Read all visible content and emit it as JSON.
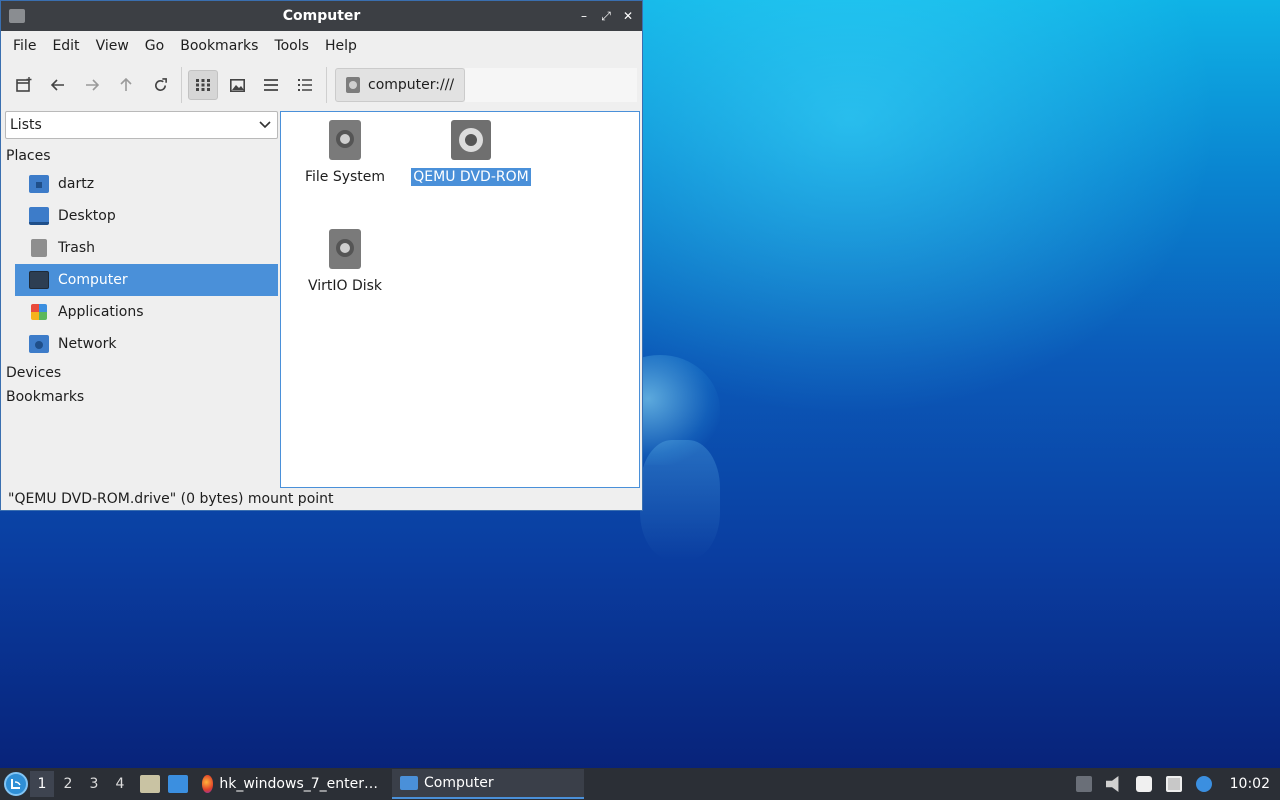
{
  "window": {
    "title": "Computer",
    "controls": {
      "minimize": "–",
      "maximize": "⤢",
      "close": "✕"
    }
  },
  "menubar": {
    "items": [
      "File",
      "Edit",
      "View",
      "Go",
      "Bookmarks",
      "Tools",
      "Help"
    ]
  },
  "toolbar": {
    "icons": [
      "new-tab-icon",
      "back-icon",
      "forward-icon",
      "up-icon",
      "reload-icon",
      "icon-view-icon",
      "thumbnail-view-icon",
      "compact-view-icon",
      "detail-view-icon"
    ],
    "path": "computer:///"
  },
  "sidebar": {
    "selector": "Lists",
    "places_header": "Places",
    "places": [
      {
        "label": "dartz",
        "icon": "home-folder-icon"
      },
      {
        "label": "Desktop",
        "icon": "desktop-icon"
      },
      {
        "label": "Trash",
        "icon": "trash-icon"
      },
      {
        "label": "Computer",
        "icon": "computer-icon",
        "selected": true
      },
      {
        "label": "Applications",
        "icon": "applications-icon"
      },
      {
        "label": "Network",
        "icon": "network-icon"
      }
    ],
    "devices_header": "Devices",
    "bookmarks_header": "Bookmarks"
  },
  "files": [
    {
      "label": "File System",
      "icon": "drive-icon"
    },
    {
      "label": "QEMU DVD-ROM",
      "icon": "optical-drive-icon",
      "selected": true
    },
    {
      "label": "VirtIO Disk",
      "icon": "drive-icon"
    }
  ],
  "status": "\"QEMU DVD-ROM.drive\" (0 bytes) mount point",
  "taskbar": {
    "workspaces": [
      "1",
      "2",
      "3",
      "4"
    ],
    "active_workspace": "1",
    "tasks": [
      {
        "label": "hk_windows_7_enter…",
        "icon": "firefox-icon"
      },
      {
        "label": "Computer",
        "icon": "file-manager-icon",
        "active": true
      }
    ],
    "clock": "10:02"
  },
  "colors": {
    "selection": "#4a90d9",
    "titlebar": "#3c3f44",
    "taskbar": "#2b2f36"
  }
}
